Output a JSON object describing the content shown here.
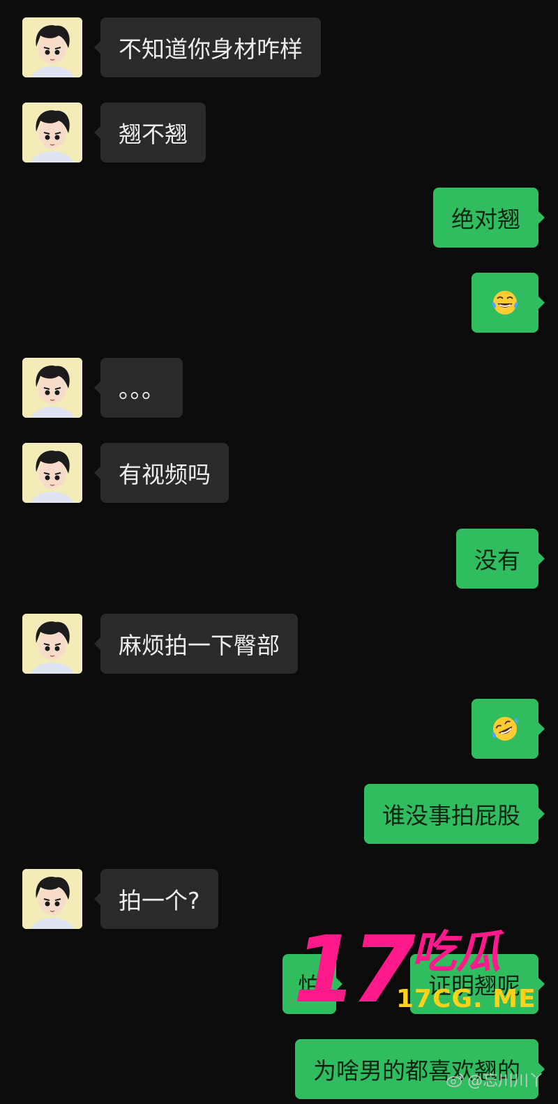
{
  "messages": [
    {
      "side": "in",
      "text": "不知道你身材咋样"
    },
    {
      "side": "in",
      "text": "翘不翘"
    },
    {
      "side": "out",
      "text": "绝对翘"
    },
    {
      "side": "out",
      "emoji": "tears-of-joy"
    },
    {
      "side": "in",
      "text": "。。。"
    },
    {
      "side": "in",
      "text": "有视频吗"
    },
    {
      "side": "out",
      "text": "没有"
    },
    {
      "side": "in",
      "text": "麻烦拍一下臀部"
    },
    {
      "side": "out",
      "emoji": "rolling-laughing"
    },
    {
      "side": "out",
      "text": "谁没事拍屁股"
    },
    {
      "side": "in",
      "text": "拍一个?"
    },
    {
      "side": "out",
      "text": "怕"
    },
    {
      "side": "out",
      "text": "证明翘呢"
    },
    {
      "side": "out",
      "text": "为啥男的都喜欢翘的"
    }
  ],
  "watermark": {
    "number": "17",
    "name": "吃瓜",
    "url": "17CG. ME"
  },
  "weibo_handle": "@忘川川丫",
  "colors": {
    "background": "#0b0b0b",
    "incoming_bubble": "#2a2a2a",
    "outgoing_bubble": "#2fbd60",
    "watermark_pink": "#ff1a8c",
    "watermark_yellow": "#ffd21a"
  }
}
